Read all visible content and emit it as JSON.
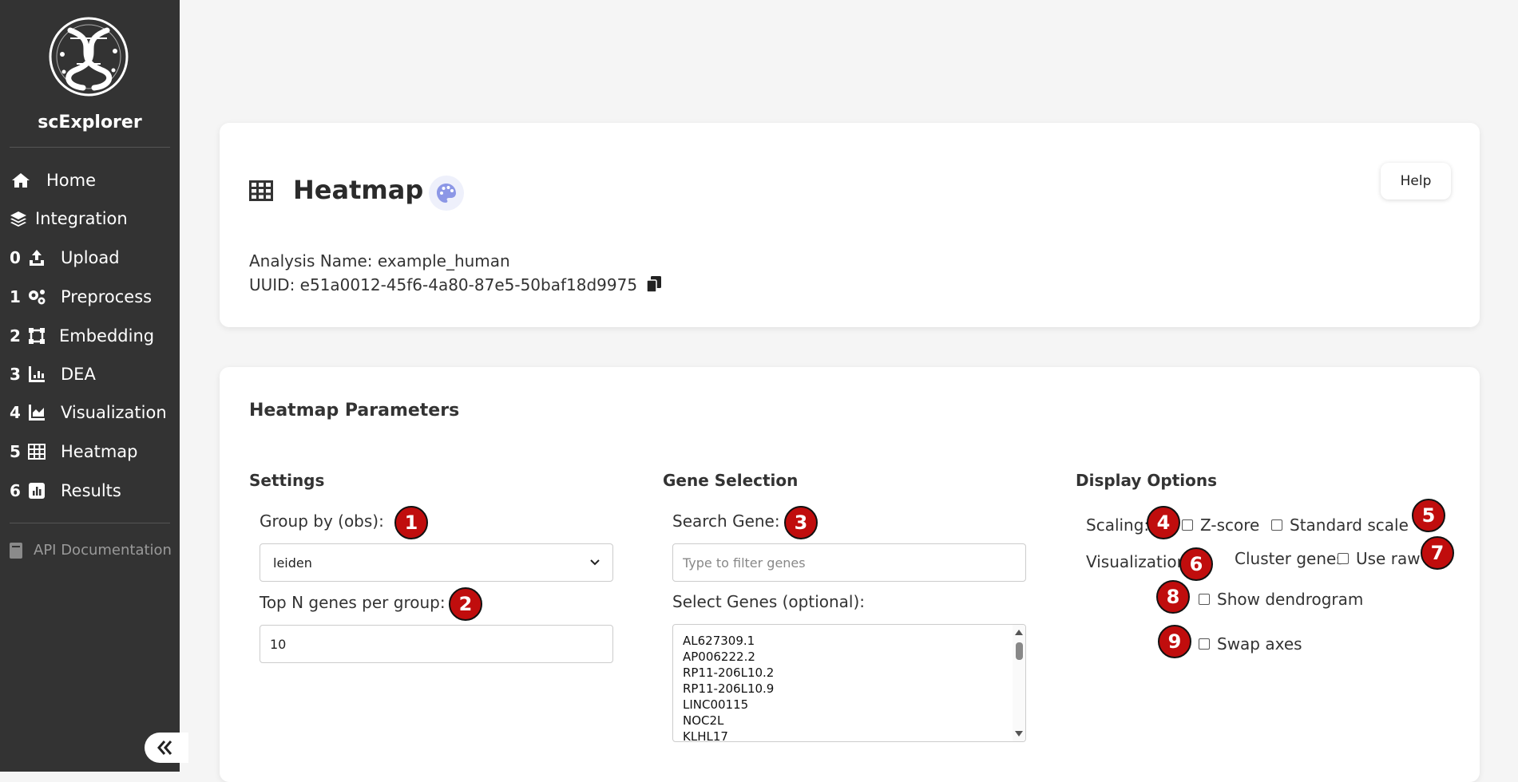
{
  "app": {
    "brand": "scExplorer",
    "logo": "helix-network-logo"
  },
  "nav": [
    {
      "num": "",
      "label": "Home",
      "icon": "home-icon"
    },
    {
      "num": "",
      "label": "Integration",
      "icon": "layers-icon"
    },
    {
      "num": "0",
      "label": "Upload",
      "icon": "upload-icon"
    },
    {
      "num": "1",
      "label": "Preprocess",
      "icon": "gears-icon"
    },
    {
      "num": "2",
      "label": "Embedding",
      "icon": "vector-square-icon"
    },
    {
      "num": "3",
      "label": "DEA",
      "icon": "bar-chart-icon"
    },
    {
      "num": "4",
      "label": "Visualization",
      "icon": "area-chart-icon"
    },
    {
      "num": "5",
      "label": "Heatmap",
      "icon": "table-icon"
    },
    {
      "num": "6",
      "label": "Results",
      "icon": "square-chart-icon"
    }
  ],
  "api_link": "API Documentation",
  "header": {
    "title": "Heatmap",
    "help_label": "Help",
    "analysis_name": "Analysis Name: example_human",
    "uuid": "UUID: e51a0012-45f6-4a80-87e5-50baf18d9975"
  },
  "params": {
    "title": "Heatmap Parameters",
    "settings": {
      "heading": "Settings",
      "group_label": "Group by (obs):",
      "group_value": "leiden",
      "topn_label": "Top N genes per group:",
      "topn_value": "10"
    },
    "genes": {
      "heading": "Gene Selection",
      "search_label": "Search Gene:",
      "search_placeholder": "Type to filter genes",
      "select_label": "Select Genes (optional):",
      "options": [
        "AL627309.1",
        "AP006222.2",
        "RP11-206L10.2",
        "RP11-206L10.9",
        "LINC00115",
        "NOC2L",
        "KLHL17"
      ]
    },
    "display": {
      "heading": "Display Options",
      "scaling_label": "Scaling:",
      "zscore": "Z-score",
      "standard_scale": "Standard scale",
      "visualization_label": "Visualization:",
      "cluster_genes": "Cluster genes",
      "use_raw": "Use raw",
      "show_dendrogram": "Show dendrogram",
      "swap_axes": "Swap axes"
    }
  },
  "badges": [
    "1",
    "2",
    "3",
    "4",
    "5",
    "6",
    "7",
    "8",
    "9"
  ],
  "colors": {
    "sidebar": "#333333",
    "badge": "#c00d0d",
    "palette_accent": "#8c97e6"
  }
}
